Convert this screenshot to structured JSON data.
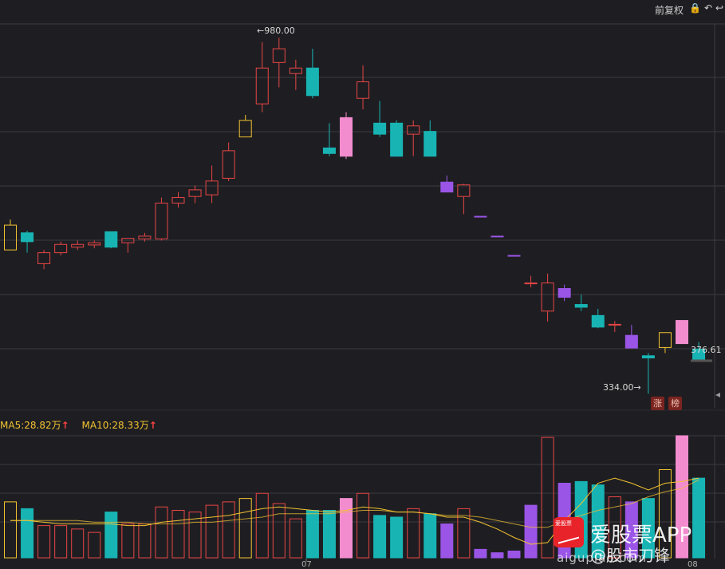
{
  "toolbar": {
    "restore_label": "前复权",
    "lock_icon": "lock-icon",
    "undo_icon": "undo-icon",
    "back_icon": "back-icon"
  },
  "price_labels": {
    "high": "←980.00",
    "low": "334.00→",
    "last": "376.61"
  },
  "ma": {
    "ma5": "MA5:28.82万",
    "ma10": "MA10:28.33万",
    "up_arrow": "↑"
  },
  "badges": {
    "zhang": "涨",
    "bang": "榜"
  },
  "x_ticks": {
    "jul": "07",
    "aug": "08"
  },
  "watermark": {
    "logo_text": "爱股票",
    "app": "爱股票APP",
    "weibo": "@股市刀锋",
    "url": "aigupiao.com"
  },
  "colors": {
    "up": "#e84545",
    "down": "#18b4b4",
    "doji_yellow": "#f2c230",
    "doji_purple": "#9b55e6",
    "doji_pink": "#f28ccf",
    "ma_line": "#f2c230",
    "grid": "#3a3a40"
  },
  "chart_data": {
    "type": "candlestick",
    "price_range": [
      310,
      1005
    ],
    "candles": [
      {
        "o": 640,
        "h": 650,
        "l": 595,
        "c": 595,
        "style": "yellow"
      },
      {
        "o": 610,
        "h": 630,
        "l": 590,
        "c": 626,
        "style": "down"
      },
      {
        "o": 570,
        "h": 595,
        "l": 560,
        "c": 590,
        "style": "up"
      },
      {
        "o": 590,
        "h": 610,
        "l": 585,
        "c": 605,
        "style": "up"
      },
      {
        "o": 600,
        "h": 612,
        "l": 595,
        "c": 605,
        "style": "up"
      },
      {
        "o": 604,
        "h": 612,
        "l": 598,
        "c": 608,
        "style": "up"
      },
      {
        "o": 600,
        "h": 628,
        "l": 598,
        "c": 628,
        "style": "down"
      },
      {
        "o": 608,
        "h": 616,
        "l": 590,
        "c": 616,
        "style": "up"
      },
      {
        "o": 615,
        "h": 626,
        "l": 610,
        "c": 620,
        "style": "up"
      },
      {
        "o": 615,
        "h": 690,
        "l": 612,
        "c": 680,
        "style": "up"
      },
      {
        "o": 680,
        "h": 700,
        "l": 672,
        "c": 690,
        "style": "up"
      },
      {
        "o": 692,
        "h": 712,
        "l": 680,
        "c": 704,
        "style": "up"
      },
      {
        "o": 695,
        "h": 748,
        "l": 680,
        "c": 720,
        "style": "up"
      },
      {
        "o": 725,
        "h": 790,
        "l": 720,
        "c": 775,
        "style": "up"
      },
      {
        "o": 830,
        "h": 840,
        "l": 800,
        "c": 800,
        "style": "yellow"
      },
      {
        "o": 860,
        "h": 972,
        "l": 845,
        "c": 925,
        "style": "up"
      },
      {
        "o": 935,
        "h": 980,
        "l": 890,
        "c": 960,
        "style": "up"
      },
      {
        "o": 915,
        "h": 940,
        "l": 885,
        "c": 925,
        "style": "up"
      },
      {
        "o": 925,
        "h": 960,
        "l": 870,
        "c": 875,
        "style": "down"
      },
      {
        "o": 780,
        "h": 825,
        "l": 765,
        "c": 770,
        "style": "down"
      },
      {
        "o": 835,
        "h": 845,
        "l": 760,
        "c": 765,
        "style": "pink"
      },
      {
        "o": 870,
        "h": 930,
        "l": 850,
        "c": 900,
        "style": "up"
      },
      {
        "o": 825,
        "h": 865,
        "l": 800,
        "c": 805,
        "style": "down"
      },
      {
        "o": 825,
        "h": 830,
        "l": 765,
        "c": 765,
        "style": "down"
      },
      {
        "o": 805,
        "h": 830,
        "l": 765,
        "c": 820,
        "style": "up"
      },
      {
        "o": 810,
        "h": 830,
        "l": 765,
        "c": 765,
        "style": "down"
      },
      {
        "o": 718,
        "h": 730,
        "l": 700,
        "c": 700,
        "style": "purple"
      },
      {
        "o": 692,
        "h": 715,
        "l": 660,
        "c": 713,
        "style": "up"
      },
      {
        "o": 656,
        "h": 656,
        "l": 656,
        "c": 656,
        "style": "purple"
      },
      {
        "o": 620,
        "h": 620,
        "l": 620,
        "c": 620,
        "style": "purple"
      },
      {
        "o": 585,
        "h": 585,
        "l": 585,
        "c": 585,
        "style": "purple"
      },
      {
        "o": 535,
        "h": 548,
        "l": 527,
        "c": 535,
        "style": "up"
      },
      {
        "o": 484,
        "h": 552,
        "l": 465,
        "c": 535,
        "style": "up"
      },
      {
        "o": 525,
        "h": 532,
        "l": 502,
        "c": 509,
        "style": "purple"
      },
      {
        "o": 496,
        "h": 514,
        "l": 484,
        "c": 491,
        "style": "down"
      },
      {
        "o": 476,
        "h": 488,
        "l": 453,
        "c": 455,
        "style": "down"
      },
      {
        "o": 459,
        "h": 466,
        "l": 446,
        "c": 460,
        "style": "up"
      },
      {
        "o": 440,
        "h": 459,
        "l": 417,
        "c": 417,
        "style": "purple"
      },
      {
        "o": 403,
        "h": 408,
        "l": 334,
        "c": 399,
        "style": "down"
      },
      {
        "o": 418,
        "h": 445,
        "l": 408,
        "c": 445,
        "style": "yellow"
      },
      {
        "o": 467,
        "h": 467,
        "l": 425,
        "c": 425,
        "style": "pink"
      },
      {
        "o": 415,
        "h": 428,
        "l": 395,
        "c": 395,
        "style": "down"
      }
    ],
    "volume": [
      {
        "v": 33,
        "style": "yellow"
      },
      {
        "v": 29,
        "style": "down"
      },
      {
        "v": 19,
        "style": "up"
      },
      {
        "v": 19,
        "style": "up"
      },
      {
        "v": 17,
        "style": "up"
      },
      {
        "v": 15,
        "style": "up"
      },
      {
        "v": 27,
        "style": "down"
      },
      {
        "v": 20,
        "style": "up"
      },
      {
        "v": 20,
        "style": "up"
      },
      {
        "v": 30,
        "style": "up"
      },
      {
        "v": 28,
        "style": "up"
      },
      {
        "v": 27,
        "style": "up"
      },
      {
        "v": 31,
        "style": "up"
      },
      {
        "v": 33,
        "style": "up"
      },
      {
        "v": 35,
        "style": "yellow"
      },
      {
        "v": 38,
        "style": "up"
      },
      {
        "v": 32,
        "style": "up"
      },
      {
        "v": 23,
        "style": "up"
      },
      {
        "v": 28,
        "style": "down"
      },
      {
        "v": 28,
        "style": "down"
      },
      {
        "v": 35,
        "style": "pink"
      },
      {
        "v": 38,
        "style": "up"
      },
      {
        "v": 25,
        "style": "down"
      },
      {
        "v": 24,
        "style": "down"
      },
      {
        "v": 29,
        "style": "up"
      },
      {
        "v": 26,
        "style": "down"
      },
      {
        "v": 20,
        "style": "purple"
      },
      {
        "v": 29,
        "style": "up"
      },
      {
        "v": 5,
        "style": "purple"
      },
      {
        "v": 3,
        "style": "purple"
      },
      {
        "v": 4,
        "style": "purple"
      },
      {
        "v": 31,
        "style": "purple"
      },
      {
        "v": 71,
        "style": "up"
      },
      {
        "v": 44,
        "style": "purple"
      },
      {
        "v": 45,
        "style": "down"
      },
      {
        "v": 43,
        "style": "down"
      },
      {
        "v": 36,
        "style": "up"
      },
      {
        "v": 33,
        "style": "purple"
      },
      {
        "v": 35,
        "style": "down"
      },
      {
        "v": 52,
        "style": "yellow"
      },
      {
        "v": 72,
        "style": "pink"
      },
      {
        "v": 47,
        "style": "down"
      }
    ],
    "volume_range": [
      0,
      72
    ],
    "ma5": [
      22,
      22,
      21,
      20,
      20,
      20,
      20,
      19,
      19,
      21,
      22,
      23,
      24,
      25,
      27,
      29,
      30,
      29,
      28,
      27,
      28,
      30,
      29,
      27,
      27,
      26,
      24,
      24,
      21,
      17,
      12,
      8,
      9,
      22,
      32,
      44,
      47,
      44,
      40,
      44,
      45,
      47
    ],
    "ma10": [
      22,
      22,
      22,
      22,
      22,
      21,
      21,
      21,
      20,
      20,
      20,
      21,
      21,
      22,
      23,
      24,
      26,
      26,
      26,
      26,
      27,
      28,
      28,
      27,
      27,
      26,
      25,
      25,
      24,
      22,
      20,
      18,
      18,
      22,
      25,
      28,
      30,
      32,
      36,
      39,
      41,
      46
    ]
  }
}
